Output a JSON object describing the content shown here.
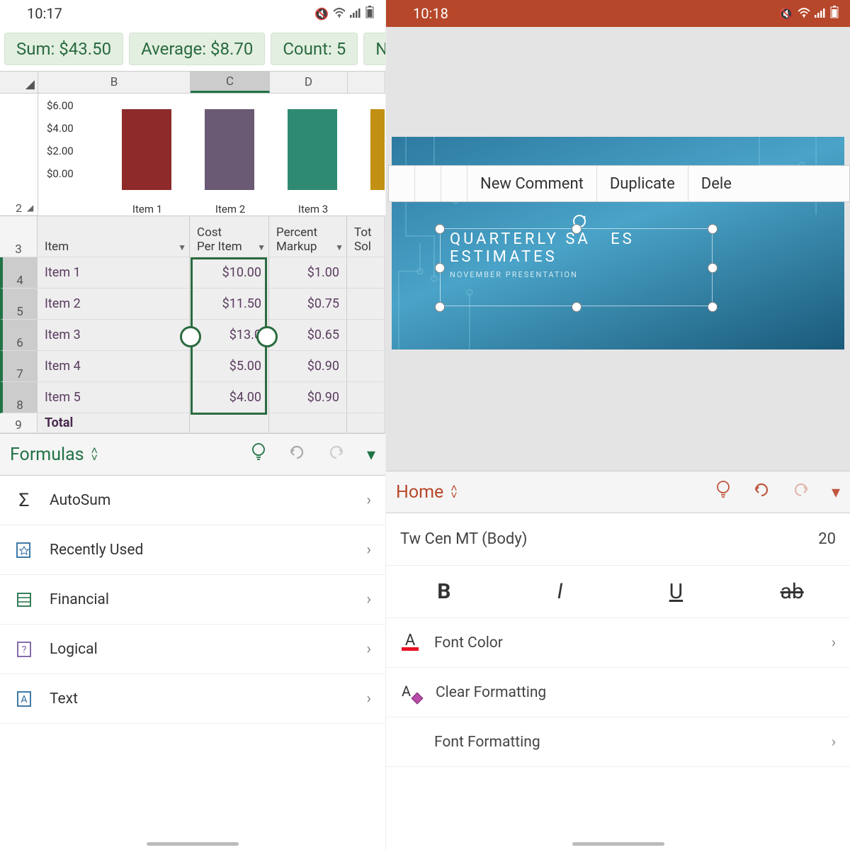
{
  "left": {
    "status_time": "10:17",
    "pills": {
      "sum": "Sum: $43.50",
      "avg": "Average: $8.70",
      "count": "Count: 5",
      "num": "Num"
    },
    "columns": [
      "B",
      "C",
      "D"
    ],
    "yticks": [
      "$6.00",
      "$4.00",
      "$2.00",
      "$0.00"
    ],
    "bar_labels": [
      "Item 1",
      "Item 2",
      "Item 3"
    ],
    "row_header_nums": [
      "2",
      "3",
      "4",
      "5",
      "6",
      "7",
      "8",
      "9"
    ],
    "table": {
      "headers": {
        "item": "Item",
        "cost": "Cost\nPer Item",
        "markup": "Percent\nMarkup",
        "total": "Tot\nSol"
      },
      "rows": [
        {
          "item": "Item 1",
          "cost": "$10.00",
          "markup": "$1.00"
        },
        {
          "item": "Item 2",
          "cost": "$11.50",
          "markup": "$0.75"
        },
        {
          "item": "Item 3",
          "cost": "$13.0",
          "markup": "$0.65"
        },
        {
          "item": "Item 4",
          "cost": "$5.00",
          "markup": "$0.90"
        },
        {
          "item": "Item 5",
          "cost": "$4.00",
          "markup": "$0.90"
        }
      ],
      "total_label": "Total"
    },
    "toolbar_tab": "Formulas",
    "menu": [
      "AutoSum",
      "Recently Used",
      "Financial",
      "Logical",
      "Text"
    ]
  },
  "right": {
    "status_time": "10:18",
    "context": {
      "new_comment": "New Comment",
      "duplicate": "Duplicate",
      "delete": "Dele"
    },
    "slide": {
      "title1": "QUARTERLY SA",
      "title1b": "ES",
      "title2": "ESTIMATES",
      "sub": "NOVEMBER PRESENTATION"
    },
    "toolbar_tab": "Home",
    "font": {
      "name": "Tw Cen MT (Body)",
      "size": "20"
    },
    "styles": {
      "bold": "B",
      "italic": "I",
      "underline": "U",
      "strike": "ab"
    },
    "menu": {
      "font_color": "Font Color",
      "clear_fmt": "Clear Formatting",
      "font_fmt": "Font Formatting"
    }
  },
  "chart_data": {
    "type": "bar",
    "categories": [
      "Item 1",
      "Item 2",
      "Item 3"
    ],
    "values": [
      6.0,
      6.0,
      6.0
    ],
    "colors": [
      "#8e2a2a",
      "#6a5a74",
      "#2f8a74",
      "#c29012"
    ],
    "ylabel": "",
    "ylim": [
      0,
      6
    ],
    "yticks": [
      "$0.00",
      "$2.00",
      "$4.00",
      "$6.00"
    ]
  },
  "excel_data": {
    "selected_column": "C",
    "rows": [
      {
        "Item": "Item 1",
        "Cost Per Item": 10.0,
        "Percent Markup": 1.0
      },
      {
        "Item": "Item 2",
        "Cost Per Item": 11.5,
        "Percent Markup": 0.75
      },
      {
        "Item": "Item 3",
        "Cost Per Item": 13.0,
        "Percent Markup": 0.65
      },
      {
        "Item": "Item 4",
        "Cost Per Item": 5.0,
        "Percent Markup": 0.9
      },
      {
        "Item": "Item 5",
        "Cost Per Item": 4.0,
        "Percent Markup": 0.9
      }
    ],
    "sum": 43.5,
    "average": 8.7,
    "count": 5
  }
}
